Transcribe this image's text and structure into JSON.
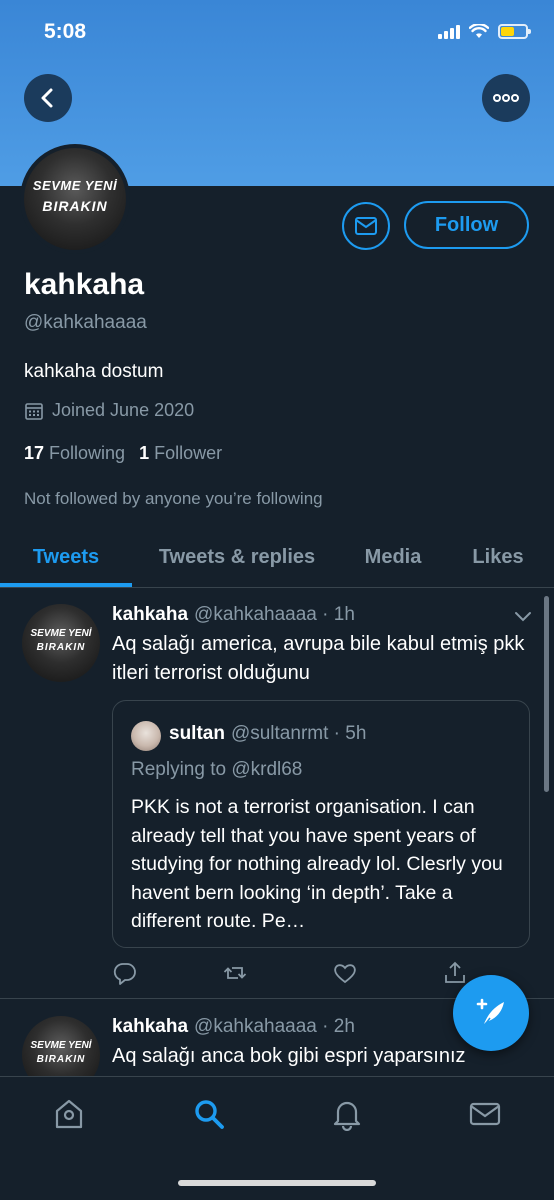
{
  "status_bar": {
    "time": "5:08",
    "battery_color": "#ffd60a"
  },
  "colors": {
    "accent": "#1d9bf0",
    "background": "#15202b",
    "banner": "#3a86d6",
    "muted": "#8899a6",
    "border": "#38444d"
  },
  "profile": {
    "avatar_text_top": "SEVME YENİ",
    "avatar_text_bottom": "BIRAKIN",
    "follow_label": "Follow",
    "name": "kahkaha",
    "handle": "@kahkahaaaa",
    "bio": "kahkaha dostum",
    "joined": "Joined June 2020",
    "following_count": "17",
    "following_label": "Following",
    "followers_count": "1",
    "followers_label": "Follower",
    "not_followed": "Not followed by anyone you’re following"
  },
  "tabs": [
    {
      "label": "Tweets",
      "active": true
    },
    {
      "label": "Tweets & replies",
      "active": false
    },
    {
      "label": "Media",
      "active": false
    },
    {
      "label": "Likes",
      "active": false
    }
  ],
  "tweets": [
    {
      "name": "kahkaha",
      "meta": "@kahkahaaaa · 1h",
      "text": "Aq salağı america, avrupa bile kabul etmiş pkk itleri terrorist olduğunu",
      "quote": {
        "name": "sultan",
        "meta": "@sultanrmt · 5h",
        "replying": "Replying to @krdl68",
        "text": "PKK is not a terrorist organisation. I can already tell that you have spent years of studying for nothing already lol. Clesrly you havent bern looking ‘in depth’. Take a different route. Pe…"
      }
    },
    {
      "name": "kahkaha",
      "meta": "@kahkahaaaa · 2h",
      "text": "Aq salağı anca bok gibi espri yaparsınız"
    }
  ],
  "icons": {
    "back": "arrow-left-icon",
    "more": "more-dots-icon",
    "message": "envelope-icon",
    "calendar": "calendar-icon",
    "reply": "reply-icon",
    "retweet": "retweet-icon",
    "like": "heart-icon",
    "share": "share-icon",
    "compose": "compose-tweet-icon",
    "nav": [
      "home-icon",
      "search-icon",
      "notifications-icon",
      "messages-icon"
    ]
  }
}
